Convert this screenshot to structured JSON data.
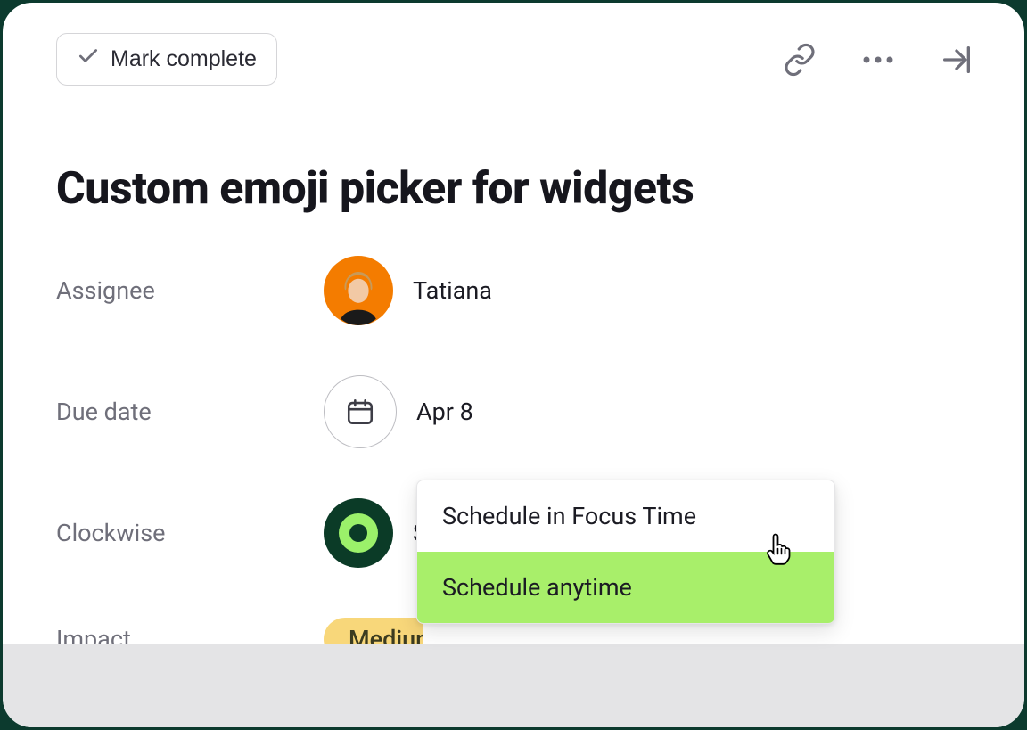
{
  "header": {
    "mark_complete_label": "Mark complete"
  },
  "task": {
    "title": "Custom emoji picker for widgets"
  },
  "fields": {
    "assignee": {
      "label": "Assignee",
      "value": "Tatiana"
    },
    "due_date": {
      "label": "Due date",
      "value": "Apr 8"
    },
    "clockwise": {
      "label": "Clockwise",
      "value": "Schedule with Clockwise"
    },
    "impact": {
      "label": "Impact",
      "value": "Medium"
    }
  },
  "dropdown": {
    "items": [
      {
        "label": "Schedule in Focus Time",
        "highlighted": false
      },
      {
        "label": "Schedule anytime",
        "highlighted": true
      }
    ]
  },
  "colors": {
    "accent_green": "#a8ef6a",
    "pill_yellow": "#f8d77a",
    "brand_green": "#0b3b27"
  }
}
